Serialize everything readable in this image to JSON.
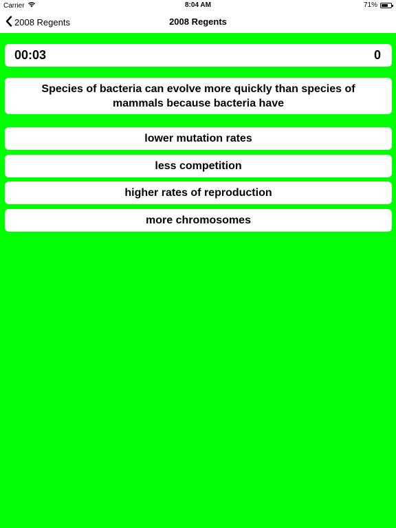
{
  "status_bar": {
    "carrier": "Carrier",
    "time": "8:04 AM",
    "battery": "71%",
    "battery_level": 0.71
  },
  "nav": {
    "back_label": "2008 Regents",
    "title": "2008 Regents"
  },
  "quiz": {
    "timer": "00:03",
    "score": "0",
    "question": "Species of bacteria can evolve more quickly than species of mammals because bacteria have",
    "answers": [
      "lower mutation rates",
      "less competition",
      "higher rates of reproduction",
      "more chromosomes"
    ]
  },
  "colors": {
    "background": "#00ff00",
    "card": "#ffffff"
  }
}
